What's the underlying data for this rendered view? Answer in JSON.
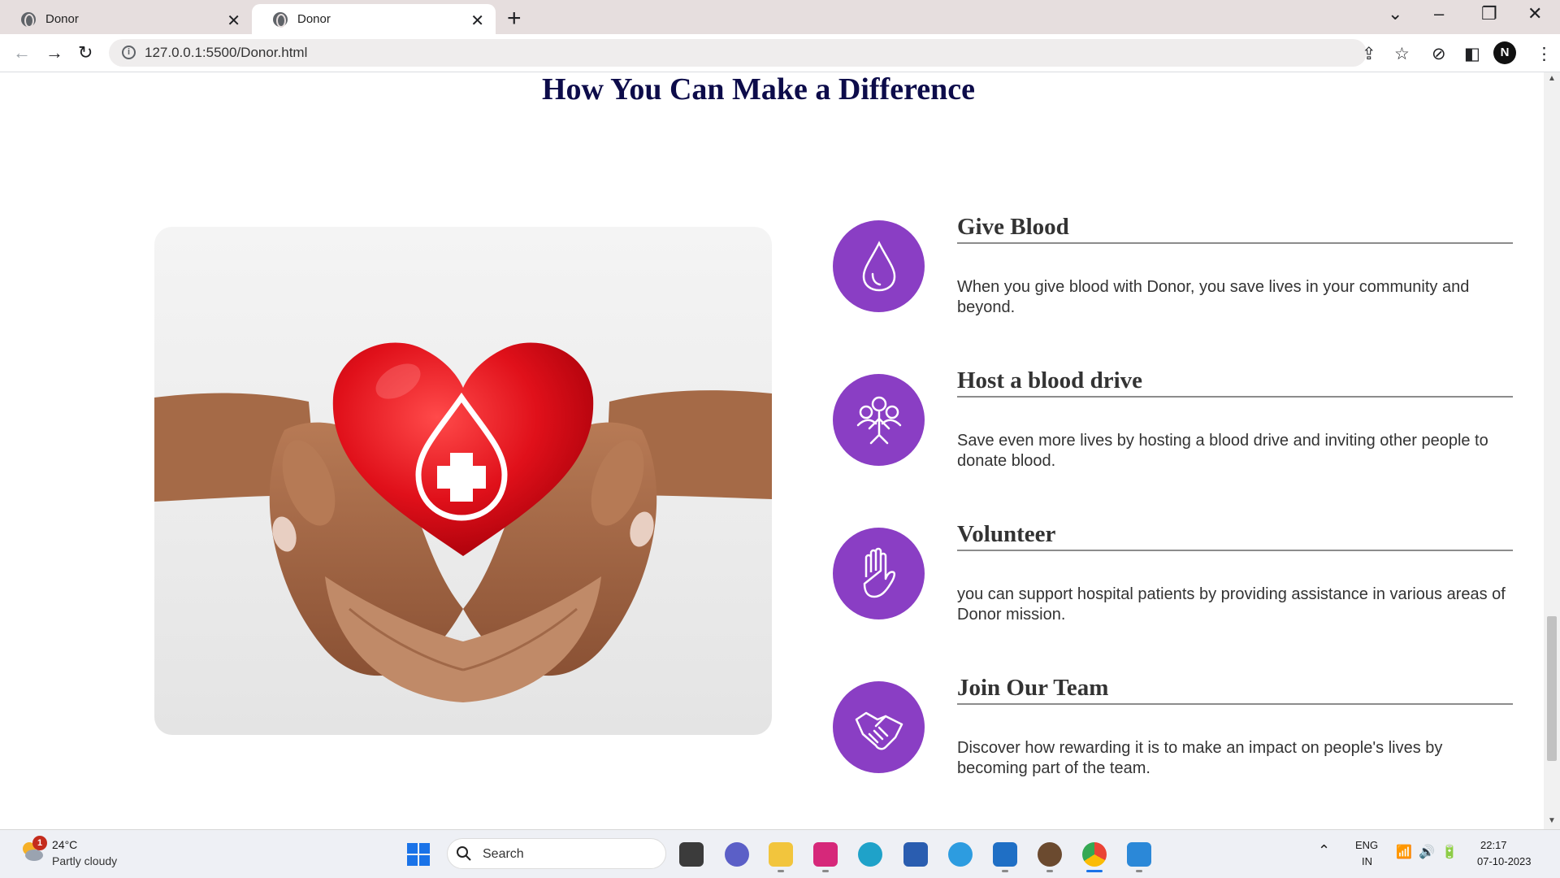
{
  "browser": {
    "tabs": [
      {
        "title": "Donor",
        "active": false
      },
      {
        "title": "Donor",
        "active": true
      }
    ],
    "url": "127.0.0.1:5500/Donor.html",
    "profile_initial": "N"
  },
  "page": {
    "title": "How You Can Make a Difference",
    "accent_color": "#8a3ec4",
    "title_color": "#0d0c4a",
    "items": [
      {
        "icon": "blood-drop-icon",
        "title": "Give Blood",
        "text": "When you give blood with Donor, you save lives in your community and beyond."
      },
      {
        "icon": "people-group-icon",
        "title": "Host a blood drive",
        "text": "Save even more lives by hosting a blood drive and inviting other people to donate blood."
      },
      {
        "icon": "raised-hand-icon",
        "title": "Volunteer",
        "text": "you can support hospital patients by providing assistance in various areas of Donor mission."
      },
      {
        "icon": "handshake-icon",
        "title": "Join Our Team",
        "text": "Discover how rewarding it is to make an impact on people's lives by becoming part of the team."
      }
    ]
  },
  "taskbar": {
    "weather_badge": "1",
    "weather_temp": "24°C",
    "weather_condition": "Partly cloudy",
    "search_label": "Search",
    "lang_line1": "ENG",
    "lang_line2": "IN",
    "time": "22:17",
    "date": "07-10-2023"
  }
}
